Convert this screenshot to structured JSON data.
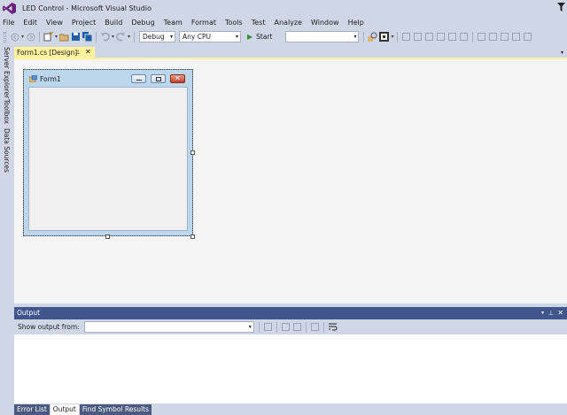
{
  "window": {
    "title": "LED Control - Microsoft Visual Studio"
  },
  "menu": [
    "File",
    "Edit",
    "View",
    "Project",
    "Build",
    "Debug",
    "Team",
    "Format",
    "Tools",
    "Test",
    "Analyze",
    "Window",
    "Help"
  ],
  "toolbar": {
    "configuration": "Debug",
    "platform": "Any CPU",
    "start_label": "Start"
  },
  "side_rail": [
    "Server Explorer",
    "Toolbox",
    "Data Sources"
  ],
  "document_tab": {
    "label": "Form1.cs [Design]"
  },
  "form": {
    "title": "Form1"
  },
  "output": {
    "title": "Output",
    "show_output_from_label": "Show output from:",
    "source_value": ""
  },
  "bottom_tabs": [
    "Error List",
    "Output",
    "Find Symbol Results"
  ],
  "colors": {
    "chrome": "#cfd6e5",
    "tool_window_header": "#40568d",
    "active_doc_tab": "#fff29d",
    "vs_purple": "#68217a"
  }
}
